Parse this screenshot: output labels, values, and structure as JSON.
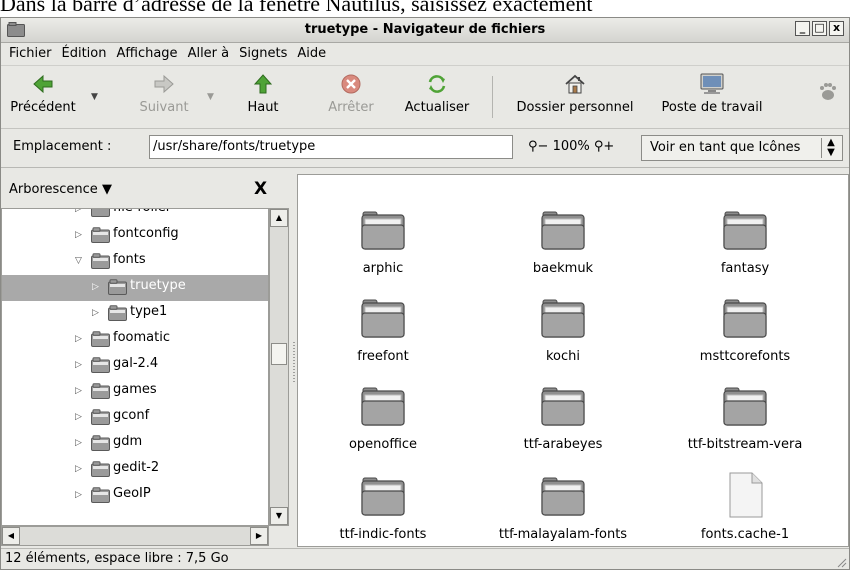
{
  "caption": "Dans la barre d’adresse de la fenêtre Nautilus, saisissez exactement",
  "window": {
    "title": "truetype - Navigateur de fichiers",
    "controls": [
      "_",
      "□",
      "x"
    ]
  },
  "menu": [
    {
      "label": "Fichier"
    },
    {
      "label": "Édition"
    },
    {
      "label": "Affichage"
    },
    {
      "label": "Aller à"
    },
    {
      "label": "Signets"
    },
    {
      "label": "Aide"
    }
  ],
  "toolbar": {
    "back": "Précédent",
    "forward": "Suivant",
    "up": "Haut",
    "stop": "Arrêter",
    "reload": "Actualiser",
    "home": "Dossier personnel",
    "computer": "Poste de travail",
    "icons": {
      "back": "left-arrow-icon",
      "forward": "right-arrow-icon",
      "up": "up-arrow-icon",
      "stop": "stop-icon",
      "reload": "reload-icon",
      "home": "home-icon",
      "computer": "computer-icon",
      "gnome": "gnome-foot-icon"
    },
    "colors": {
      "arrow": "#3f8f2a",
      "stop": "#c0392b",
      "disabled": "#9a9a96"
    }
  },
  "location": {
    "label": "Emplacement :",
    "value": "/usr/share/fonts/truetype",
    "zoom": "100%",
    "view_mode": "Voir en tant que Icônes"
  },
  "sidebar": {
    "title": "Arborescence",
    "close": "X",
    "items": [
      {
        "label": "file-roller",
        "expanded": false,
        "selected": false,
        "depth": 1
      },
      {
        "label": "fontconfig",
        "expanded": false,
        "selected": false,
        "depth": 1
      },
      {
        "label": "fonts",
        "expanded": true,
        "selected": false,
        "depth": 1
      },
      {
        "label": "truetype",
        "expanded": false,
        "selected": true,
        "depth": 2
      },
      {
        "label": "type1",
        "expanded": false,
        "selected": false,
        "depth": 2
      },
      {
        "label": "foomatic",
        "expanded": false,
        "selected": false,
        "depth": 1
      },
      {
        "label": "gal-2.4",
        "expanded": false,
        "selected": false,
        "depth": 1
      },
      {
        "label": "games",
        "expanded": false,
        "selected": false,
        "depth": 1
      },
      {
        "label": "gconf",
        "expanded": false,
        "selected": false,
        "depth": 1
      },
      {
        "label": "gdm",
        "expanded": false,
        "selected": false,
        "depth": 1
      },
      {
        "label": "gedit-2",
        "expanded": false,
        "selected": false,
        "depth": 1
      },
      {
        "label": "GeoIP",
        "expanded": false,
        "selected": false,
        "depth": 1
      }
    ]
  },
  "files": [
    {
      "name": "arphic",
      "type": "folder"
    },
    {
      "name": "baekmuk",
      "type": "folder"
    },
    {
      "name": "fantasy",
      "type": "folder"
    },
    {
      "name": "freefont",
      "type": "folder"
    },
    {
      "name": "kochi",
      "type": "folder"
    },
    {
      "name": "msttcorefonts",
      "type": "folder"
    },
    {
      "name": "openoffice",
      "type": "folder"
    },
    {
      "name": "ttf-arabeyes",
      "type": "folder"
    },
    {
      "name": "ttf-bitstream-vera",
      "type": "folder"
    },
    {
      "name": "ttf-indic-fonts",
      "type": "folder"
    },
    {
      "name": "ttf-malayalam-fonts",
      "type": "folder"
    },
    {
      "name": "fonts.cache-1",
      "type": "file"
    }
  ],
  "status": "12 éléments, espace libre : 7,5 Go"
}
